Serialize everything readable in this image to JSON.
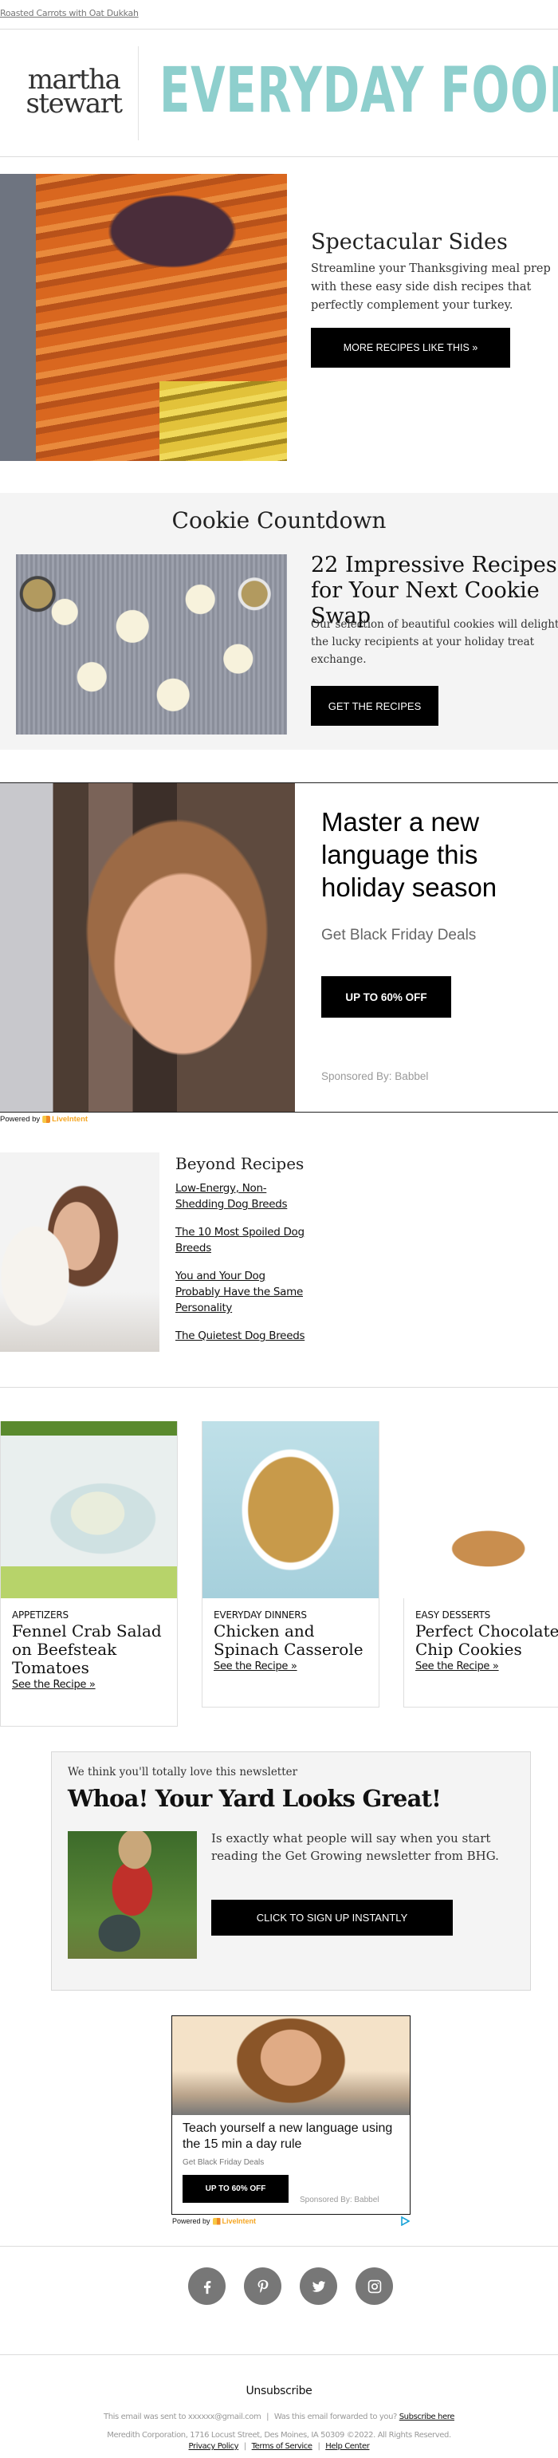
{
  "preheader": {
    "link_text": "Roasted Carrots with Oat Dukkah"
  },
  "header": {
    "logo_left_line1": "martha",
    "logo_left_line2": "stewart",
    "logo_right": "EVERYDAY FOOD",
    "brand_color": "#8ecfcd"
  },
  "hero": {
    "image": "roasted-carrots-photo",
    "title": "Spectacular Sides",
    "text": "Streamline your Thanksgiving meal prep with these easy side dish recipes that perfectly complement your turkey.",
    "button_label": "MORE RECIPES LIKE THIS »"
  },
  "cookie_section": {
    "heading": "Cookie Countdown",
    "image": "wreath-cookies-photo",
    "title": "22 Impressive Recipes for Your Next Cookie Swap",
    "text": "Our selection of beautiful cookies will delight the lucky recipients at your holiday treat exchange.",
    "button_label": "GET THE RECIPES",
    "background": "#f4f4f4"
  },
  "ad_1": {
    "image": "laughing-woman-photo",
    "title": "Master a new language  this holiday season",
    "subtitle": "Get Black Friday Deals",
    "button_label": "UP TO 60% OFF",
    "sponsor": "Sponsored By: Babbel",
    "powered_by": "Powered by",
    "powered_brand": "LiveIntent",
    "powered_brand_color": "#f5a623"
  },
  "beyond_recipes": {
    "image": "woman-with-dog-photo",
    "heading": "Beyond Recipes",
    "links": [
      "Low-Energy, Non-Shedding Dog Breeds",
      "The 10 Most Spoiled Dog Breeds",
      "You and Your Dog Probably Have the Same Personality",
      "The Quietest Dog Breeds"
    ]
  },
  "recipe_cards": [
    {
      "image": "fennel-crab-salad-photo",
      "category": "APPETIZERS",
      "title": "Fennel Crab Salad on Beefsteak Tomatoes",
      "link": "See the Recipe »"
    },
    {
      "image": "chicken-spinach-casserole-photo",
      "category": "EVERYDAY DINNERS",
      "title": "Chicken and Spinach Casserole",
      "link": "See the Recipe »"
    },
    {
      "image": "chocolate-chip-cookies-photo",
      "category": "EASY DESSERTS",
      "title": "Perfect Chocolate Chip Cookies",
      "link": "See the Recipe »"
    }
  ],
  "newsletter": {
    "kicker": "We think you'll totally love this newsletter",
    "title": "Whoa! Your Yard Looks Great!",
    "image": "gardening-woman-photo",
    "text": "Is exactly what people will say when you start reading the Get Growing newsletter from BHG.",
    "button_label": "CLICK TO SIGN UP INSTANTLY"
  },
  "ad_2": {
    "image": "smiling-man-photo",
    "title": "Teach yourself a new language using the 15 min a day rule",
    "subtitle": "Get Black Friday Deals",
    "button_label": "UP TO 60% OFF",
    "sponsor": "Sponsored By: Babbel",
    "powered_by": "Powered by",
    "powered_brand": "LiveIntent",
    "adchoices_icon": "adchoices-icon"
  },
  "social": [
    {
      "name": "facebook",
      "icon": "facebook-icon"
    },
    {
      "name": "pinterest",
      "icon": "pinterest-icon"
    },
    {
      "name": "twitter",
      "icon": "twitter-icon"
    },
    {
      "name": "instagram",
      "icon": "instagram-icon"
    }
  ],
  "footer": {
    "unsubscribe": "Unsubscribe",
    "sent_to": "This email was sent to xxxxxx@gmail.com",
    "forwarded": "Was this email forwarded to you?",
    "subscribe_link": "Subscribe here",
    "address": "Meredith Corporation, 1716 Locust Street, Des Moines, IA 50309 ©2022. All Rights Reserved.",
    "links": [
      "Privacy Policy",
      "Terms of Service",
      "Help Center"
    ],
    "separator": "|"
  }
}
